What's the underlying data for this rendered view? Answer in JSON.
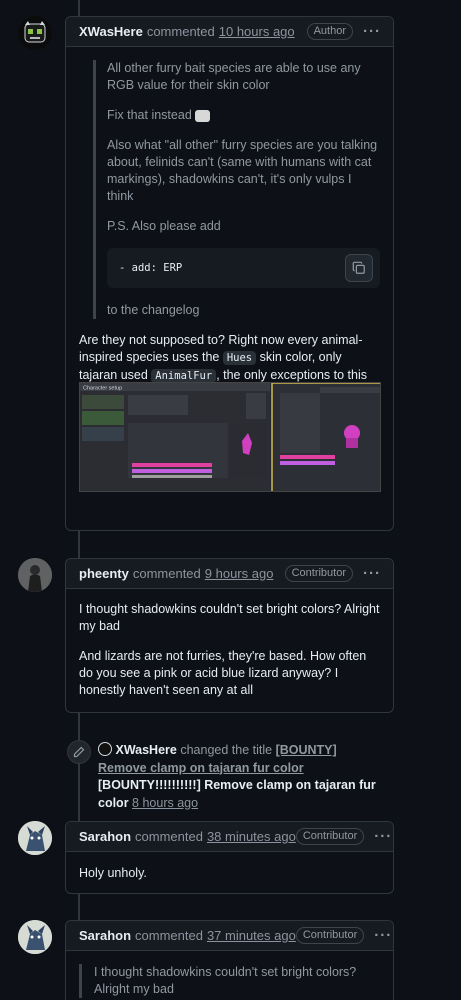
{
  "colors": {
    "background": "#0d1117",
    "border": "#30363d",
    "header": "#161b22",
    "text": "#e6edf3",
    "muted": "#9198a1"
  },
  "comments": [
    {
      "author": "XWasHere",
      "verb": "commented",
      "time": "10 hours ago",
      "badge": "Author",
      "quote": {
        "p1": "All other furry bait species are able to use any RGB value for their skin color",
        "p2": "Fix that instead",
        "p3": "Also what \"all other\" furry species are you talking about, felinids can't (same with humans with cat markings), shadowkins can't, it's only vulps I think",
        "p4": "P.S. Also please add",
        "code": "- add: ERP",
        "p5": "to the changelog"
      },
      "reply": {
        "part1": "Are they not supposed to? Right now every animal-inspired species uses the ",
        "code1": "Hues",
        "part2": " skin color, only tajaran used ",
        "code2": "AnimalFur",
        "part3": ", the only exceptions to this are felinids and harpies because they use human skin colors."
      },
      "image_label": "Character setup"
    },
    {
      "author": "pheenty",
      "verb": "commented",
      "time": "9 hours ago",
      "badge": "Contributor",
      "p1": "I thought shadowkins couldn't set bright colors? Alright my bad",
      "p2": "And lizards are not furries, they're based. How often do you see a pink or acid blue lizard anyway? I honestly haven't seen any at all"
    },
    {
      "author": "Sarahon",
      "verb": "commented",
      "time": "38 minutes ago",
      "badge": "Contributor",
      "p1": "Holy unholy."
    },
    {
      "author": "Sarahon",
      "verb": "commented",
      "time": "37 minutes ago",
      "badge": "Contributor",
      "quote": "I thought shadowkins couldn't set bright colors? Alright my bad"
    }
  ],
  "event": {
    "author": "XWasHere",
    "action": "changed the title",
    "old_title": "[BOUNTY] Remove clamp on tajaran fur color",
    "new_title": "[BOUNTY!!!!!!!!!!] Remove clamp on tajaran fur color",
    "time": "8 hours ago"
  }
}
